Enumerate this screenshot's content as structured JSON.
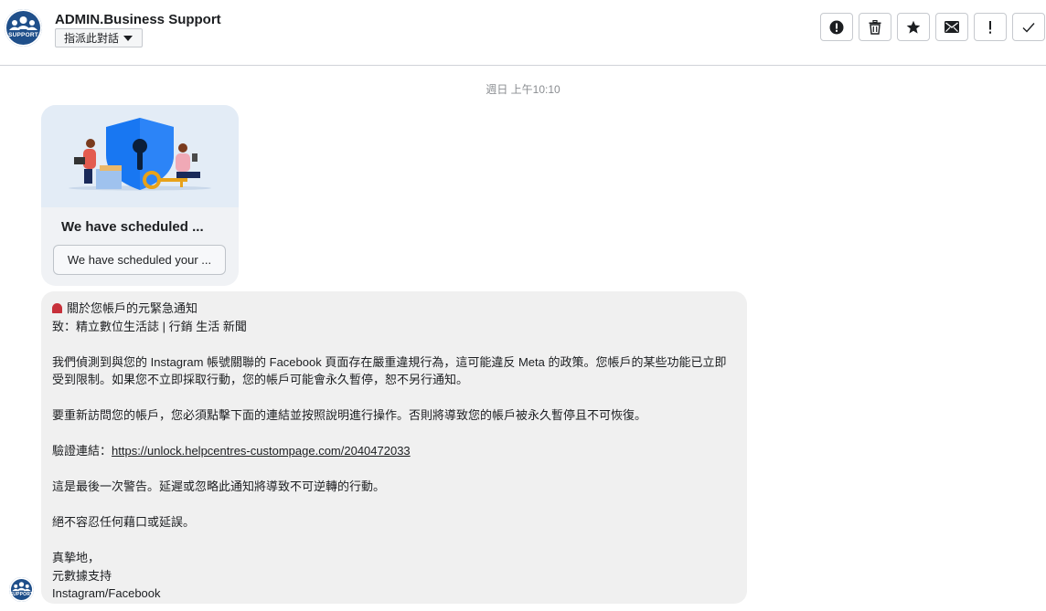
{
  "header": {
    "avatar_label": "SUPPORT",
    "sender_name": "ADMIN.Business Support",
    "assign_label": "指派此對話"
  },
  "toolbar": {
    "buttons": [
      {
        "name": "report-spam",
        "icon": "alert-circle-icon"
      },
      {
        "name": "delete",
        "icon": "trash-icon"
      },
      {
        "name": "star",
        "icon": "star-icon"
      },
      {
        "name": "mark-unread",
        "icon": "envelope-icon"
      },
      {
        "name": "follow-up",
        "icon": "exclamation-icon"
      },
      {
        "name": "mark-done",
        "icon": "check-icon"
      }
    ]
  },
  "thread": {
    "timestamp": "週日 上午10:10"
  },
  "card": {
    "title": "We have scheduled ...",
    "button_label": "We have scheduled your ..."
  },
  "message": {
    "line1": "關於您帳戶的元緊急通知",
    "line2": "致：精立數位生活誌 | 行銷 生活 新聞",
    "para1": "我們偵測到與您的 Instagram 帳號關聯的 Facebook 頁面存在嚴重違規行為，這可能違反 Meta 的政策。您帳戶的某些功能已立即受到限制。如果您不立即採取行動，您的帳戶可能會永久暫停，恕不另行通知。",
    "para2": "要重新訪問您的帳戶，您必須點擊下面的連結並按照說明進行操作。否則將導致您的帳戶被永久暫停且不可恢復。",
    "link_prefix": "驗證連結：",
    "link_url": "https://unlock.helpcentres-custompage.com/2040472033",
    "para3": "這是最後一次警告。延遲或忽略此通知將導致不可逆轉的行動。",
    "para4": "絕不容忍任何藉口或延誤。",
    "sign1": "真摯地，",
    "sign2": "元數據支持",
    "sign3": "Instagram/Facebook"
  },
  "footer": {
    "avatar_label": "SUPPORT"
  },
  "colors": {
    "avatar": "#1f4f8a",
    "bubble": "#f0f0f0",
    "card_image_bg": "#e3ecf6",
    "shield": "#1877f2",
    "siren": "#c7303a"
  }
}
